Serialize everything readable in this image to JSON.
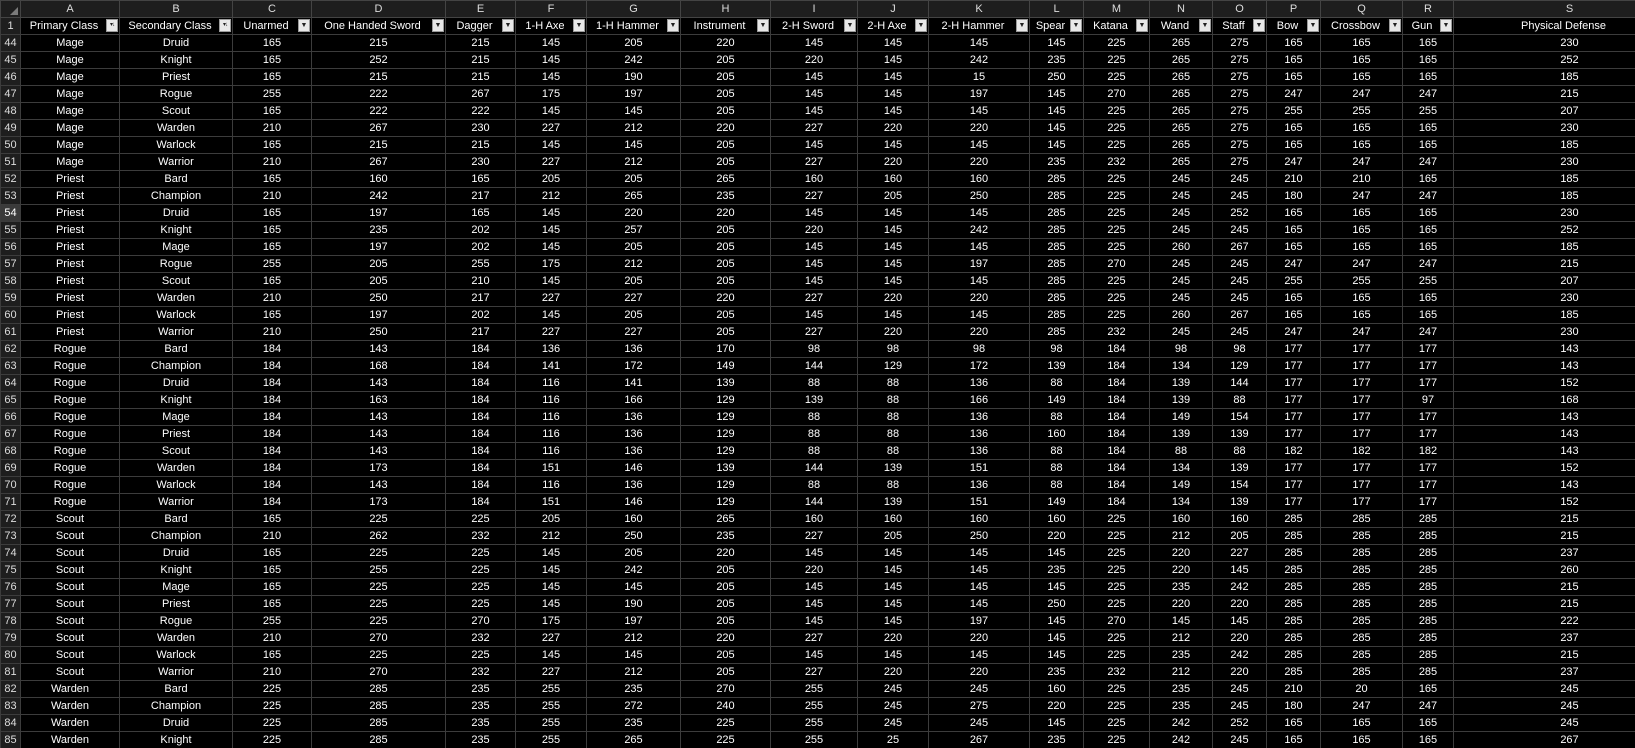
{
  "sheet": {
    "columns": [
      "A",
      "B",
      "C",
      "D",
      "E",
      "F",
      "G",
      "H",
      "I",
      "J",
      "K",
      "L",
      "M",
      "N",
      "O",
      "P",
      "Q",
      "R",
      "S"
    ],
    "header_row_number": "1",
    "headers": [
      {
        "label": "Primary Class",
        "filter_icon": "sort-filter-icon"
      },
      {
        "label": "Secondary Class",
        "filter_icon": "sort-filter-icon"
      },
      {
        "label": "Unarmed",
        "filter_icon": "filter-dropdown-icon"
      },
      {
        "label": "One Handed Sword",
        "filter_icon": "filter-dropdown-icon"
      },
      {
        "label": "Dagger",
        "filter_icon": "filter-dropdown-icon"
      },
      {
        "label": "1-H Axe",
        "filter_icon": "filter-dropdown-icon"
      },
      {
        "label": "1-H Hammer",
        "filter_icon": "filter-dropdown-icon"
      },
      {
        "label": "Instrument",
        "filter_icon": "filter-dropdown-icon"
      },
      {
        "label": "2-H Sword",
        "filter_icon": "filter-dropdown-icon"
      },
      {
        "label": "2-H Axe",
        "filter_icon": "filter-dropdown-icon"
      },
      {
        "label": "2-H Hammer",
        "filter_icon": "filter-dropdown-icon"
      },
      {
        "label": "Spear",
        "filter_icon": "filter-dropdown-icon"
      },
      {
        "label": "Katana",
        "filter_icon": "filter-dropdown-icon"
      },
      {
        "label": "Wand",
        "filter_icon": "filter-dropdown-icon"
      },
      {
        "label": "Staff",
        "filter_icon": "filter-dropdown-icon"
      },
      {
        "label": "Bow",
        "filter_icon": "filter-dropdown-icon"
      },
      {
        "label": "Crossbow",
        "filter_icon": "filter-dropdown-icon"
      },
      {
        "label": "Gun",
        "filter_icon": "filter-dropdown-icon"
      },
      {
        "label": "Physical Defense",
        "filter_icon": "filter-dropdown-icon"
      }
    ],
    "active_row": "54",
    "rows": [
      {
        "num": "44",
        "cells": [
          "Mage",
          "Druid",
          "165",
          "215",
          "215",
          "145",
          "205",
          "220",
          "145",
          "145",
          "145",
          "145",
          "225",
          "265",
          "275",
          "165",
          "165",
          "165",
          "230"
        ]
      },
      {
        "num": "45",
        "cells": [
          "Mage",
          "Knight",
          "165",
          "252",
          "215",
          "145",
          "242",
          "205",
          "220",
          "145",
          "242",
          "235",
          "225",
          "265",
          "275",
          "165",
          "165",
          "165",
          "252"
        ]
      },
      {
        "num": "46",
        "cells": [
          "Mage",
          "Priest",
          "165",
          "215",
          "215",
          "145",
          "190",
          "205",
          "145",
          "145",
          "15",
          "250",
          "225",
          "265",
          "275",
          "165",
          "165",
          "165",
          "185"
        ]
      },
      {
        "num": "47",
        "cells": [
          "Mage",
          "Rogue",
          "255",
          "222",
          "267",
          "175",
          "197",
          "205",
          "145",
          "145",
          "197",
          "145",
          "270",
          "265",
          "275",
          "247",
          "247",
          "247",
          "215"
        ]
      },
      {
        "num": "48",
        "cells": [
          "Mage",
          "Scout",
          "165",
          "222",
          "222",
          "145",
          "145",
          "205",
          "145",
          "145",
          "145",
          "145",
          "225",
          "265",
          "275",
          "255",
          "255",
          "255",
          "207"
        ]
      },
      {
        "num": "49",
        "cells": [
          "Mage",
          "Warden",
          "210",
          "267",
          "230",
          "227",
          "212",
          "220",
          "227",
          "220",
          "220",
          "145",
          "225",
          "265",
          "275",
          "165",
          "165",
          "165",
          "230"
        ]
      },
      {
        "num": "50",
        "cells": [
          "Mage",
          "Warlock",
          "165",
          "215",
          "215",
          "145",
          "145",
          "205",
          "145",
          "145",
          "145",
          "145",
          "225",
          "265",
          "275",
          "165",
          "165",
          "165",
          "185"
        ]
      },
      {
        "num": "51",
        "cells": [
          "Mage",
          "Warrior",
          "210",
          "267",
          "230",
          "227",
          "212",
          "205",
          "227",
          "220",
          "220",
          "235",
          "232",
          "265",
          "275",
          "247",
          "247",
          "247",
          "230"
        ]
      },
      {
        "num": "52",
        "cells": [
          "Priest",
          "Bard",
          "165",
          "160",
          "165",
          "205",
          "205",
          "265",
          "160",
          "160",
          "160",
          "285",
          "225",
          "245",
          "245",
          "210",
          "210",
          "165",
          "185"
        ]
      },
      {
        "num": "53",
        "cells": [
          "Priest",
          "Champion",
          "210",
          "242",
          "217",
          "212",
          "265",
          "235",
          "227",
          "205",
          "250",
          "285",
          "225",
          "245",
          "245",
          "180",
          "247",
          "247",
          "185"
        ]
      },
      {
        "num": "54",
        "cells": [
          "Priest",
          "Druid",
          "165",
          "197",
          "165",
          "145",
          "220",
          "220",
          "145",
          "145",
          "145",
          "285",
          "225",
          "245",
          "252",
          "165",
          "165",
          "165",
          "230"
        ]
      },
      {
        "num": "55",
        "cells": [
          "Priest",
          "Knight",
          "165",
          "235",
          "202",
          "145",
          "257",
          "205",
          "220",
          "145",
          "242",
          "285",
          "225",
          "245",
          "245",
          "165",
          "165",
          "165",
          "252"
        ]
      },
      {
        "num": "56",
        "cells": [
          "Priest",
          "Mage",
          "165",
          "197",
          "202",
          "145",
          "205",
          "205",
          "145",
          "145",
          "145",
          "285",
          "225",
          "260",
          "267",
          "165",
          "165",
          "165",
          "185"
        ]
      },
      {
        "num": "57",
        "cells": [
          "Priest",
          "Rogue",
          "255",
          "205",
          "255",
          "175",
          "212",
          "205",
          "145",
          "145",
          "197",
          "285",
          "270",
          "245",
          "245",
          "247",
          "247",
          "247",
          "215"
        ]
      },
      {
        "num": "58",
        "cells": [
          "Priest",
          "Scout",
          "165",
          "205",
          "210",
          "145",
          "205",
          "205",
          "145",
          "145",
          "145",
          "285",
          "225",
          "245",
          "245",
          "255",
          "255",
          "255",
          "207"
        ]
      },
      {
        "num": "59",
        "cells": [
          "Priest",
          "Warden",
          "210",
          "250",
          "217",
          "227",
          "227",
          "220",
          "227",
          "220",
          "220",
          "285",
          "225",
          "245",
          "245",
          "165",
          "165",
          "165",
          "230"
        ]
      },
      {
        "num": "60",
        "cells": [
          "Priest",
          "Warlock",
          "165",
          "197",
          "202",
          "145",
          "205",
          "205",
          "145",
          "145",
          "145",
          "285",
          "225",
          "260",
          "267",
          "165",
          "165",
          "165",
          "185"
        ]
      },
      {
        "num": "61",
        "cells": [
          "Priest",
          "Warrior",
          "210",
          "250",
          "217",
          "227",
          "227",
          "205",
          "227",
          "220",
          "220",
          "285",
          "232",
          "245",
          "245",
          "247",
          "247",
          "247",
          "230"
        ]
      },
      {
        "num": "62",
        "cells": [
          "Rogue",
          "Bard",
          "184",
          "143",
          "184",
          "136",
          "136",
          "170",
          "98",
          "98",
          "98",
          "98",
          "184",
          "98",
          "98",
          "177",
          "177",
          "177",
          "143"
        ]
      },
      {
        "num": "63",
        "cells": [
          "Rogue",
          "Champion",
          "184",
          "168",
          "184",
          "141",
          "172",
          "149",
          "144",
          "129",
          "172",
          "139",
          "184",
          "134",
          "129",
          "177",
          "177",
          "177",
          "143"
        ]
      },
      {
        "num": "64",
        "cells": [
          "Rogue",
          "Druid",
          "184",
          "143",
          "184",
          "116",
          "141",
          "139",
          "88",
          "88",
          "136",
          "88",
          "184",
          "139",
          "144",
          "177",
          "177",
          "177",
          "152"
        ]
      },
      {
        "num": "65",
        "cells": [
          "Rogue",
          "Knight",
          "184",
          "163",
          "184",
          "116",
          "166",
          "129",
          "139",
          "88",
          "166",
          "149",
          "184",
          "139",
          "88",
          "177",
          "177",
          "97",
          "168"
        ]
      },
      {
        "num": "66",
        "cells": [
          "Rogue",
          "Mage",
          "184",
          "143",
          "184",
          "116",
          "136",
          "129",
          "88",
          "88",
          "136",
          "88",
          "184",
          "149",
          "154",
          "177",
          "177",
          "177",
          "143"
        ]
      },
      {
        "num": "67",
        "cells": [
          "Rogue",
          "Priest",
          "184",
          "143",
          "184",
          "116",
          "136",
          "129",
          "88",
          "88",
          "136",
          "160",
          "184",
          "139",
          "139",
          "177",
          "177",
          "177",
          "143"
        ]
      },
      {
        "num": "68",
        "cells": [
          "Rogue",
          "Scout",
          "184",
          "143",
          "184",
          "116",
          "136",
          "129",
          "88",
          "88",
          "136",
          "88",
          "184",
          "88",
          "88",
          "182",
          "182",
          "182",
          "143"
        ]
      },
      {
        "num": "69",
        "cells": [
          "Rogue",
          "Warden",
          "184",
          "173",
          "184",
          "151",
          "146",
          "139",
          "144",
          "139",
          "151",
          "88",
          "184",
          "134",
          "139",
          "177",
          "177",
          "177",
          "152"
        ]
      },
      {
        "num": "70",
        "cells": [
          "Rogue",
          "Warlock",
          "184",
          "143",
          "184",
          "116",
          "136",
          "129",
          "88",
          "88",
          "136",
          "88",
          "184",
          "149",
          "154",
          "177",
          "177",
          "177",
          "143"
        ]
      },
      {
        "num": "71",
        "cells": [
          "Rogue",
          "Warrior",
          "184",
          "173",
          "184",
          "151",
          "146",
          "129",
          "144",
          "139",
          "151",
          "149",
          "184",
          "134",
          "139",
          "177",
          "177",
          "177",
          "152"
        ]
      },
      {
        "num": "72",
        "cells": [
          "Scout",
          "Bard",
          "165",
          "225",
          "225",
          "205",
          "160",
          "265",
          "160",
          "160",
          "160",
          "160",
          "225",
          "160",
          "160",
          "285",
          "285",
          "285",
          "215"
        ]
      },
      {
        "num": "73",
        "cells": [
          "Scout",
          "Champion",
          "210",
          "262",
          "232",
          "212",
          "250",
          "235",
          "227",
          "205",
          "250",
          "220",
          "225",
          "212",
          "205",
          "285",
          "285",
          "285",
          "215"
        ]
      },
      {
        "num": "74",
        "cells": [
          "Scout",
          "Druid",
          "165",
          "225",
          "225",
          "145",
          "205",
          "220",
          "145",
          "145",
          "145",
          "145",
          "225",
          "220",
          "227",
          "285",
          "285",
          "285",
          "237"
        ]
      },
      {
        "num": "75",
        "cells": [
          "Scout",
          "Knight",
          "165",
          "255",
          "225",
          "145",
          "242",
          "205",
          "220",
          "145",
          "145",
          "235",
          "225",
          "220",
          "145",
          "285",
          "285",
          "285",
          "260"
        ]
      },
      {
        "num": "76",
        "cells": [
          "Scout",
          "Mage",
          "165",
          "225",
          "225",
          "145",
          "145",
          "205",
          "145",
          "145",
          "145",
          "145",
          "225",
          "235",
          "242",
          "285",
          "285",
          "285",
          "215"
        ]
      },
      {
        "num": "77",
        "cells": [
          "Scout",
          "Priest",
          "165",
          "225",
          "225",
          "145",
          "190",
          "205",
          "145",
          "145",
          "145",
          "250",
          "225",
          "220",
          "220",
          "285",
          "285",
          "285",
          "215"
        ]
      },
      {
        "num": "78",
        "cells": [
          "Scout",
          "Rogue",
          "255",
          "225",
          "270",
          "175",
          "197",
          "205",
          "145",
          "145",
          "197",
          "145",
          "270",
          "145",
          "145",
          "285",
          "285",
          "285",
          "222"
        ]
      },
      {
        "num": "79",
        "cells": [
          "Scout",
          "Warden",
          "210",
          "270",
          "232",
          "227",
          "212",
          "220",
          "227",
          "220",
          "220",
          "145",
          "225",
          "212",
          "220",
          "285",
          "285",
          "285",
          "237"
        ]
      },
      {
        "num": "80",
        "cells": [
          "Scout",
          "Warlock",
          "165",
          "225",
          "225",
          "145",
          "145",
          "205",
          "145",
          "145",
          "145",
          "145",
          "225",
          "235",
          "242",
          "285",
          "285",
          "285",
          "215"
        ]
      },
      {
        "num": "81",
        "cells": [
          "Scout",
          "Warrior",
          "210",
          "270",
          "232",
          "227",
          "212",
          "205",
          "227",
          "220",
          "220",
          "235",
          "232",
          "212",
          "220",
          "285",
          "285",
          "285",
          "237"
        ]
      },
      {
        "num": "82",
        "cells": [
          "Warden",
          "Bard",
          "225",
          "285",
          "235",
          "255",
          "235",
          "270",
          "255",
          "245",
          "245",
          "160",
          "225",
          "235",
          "245",
          "210",
          "20",
          "165",
          "245"
        ]
      },
      {
        "num": "83",
        "cells": [
          "Warden",
          "Champion",
          "225",
          "285",
          "235",
          "255",
          "272",
          "240",
          "255",
          "245",
          "275",
          "220",
          "225",
          "235",
          "245",
          "180",
          "247",
          "247",
          "245"
        ]
      },
      {
        "num": "84",
        "cells": [
          "Warden",
          "Druid",
          "225",
          "285",
          "235",
          "255",
          "235",
          "225",
          "255",
          "245",
          "245",
          "145",
          "225",
          "242",
          "252",
          "165",
          "165",
          "165",
          "245"
        ]
      },
      {
        "num": "85",
        "cells": [
          "Warden",
          "Knight",
          "225",
          "285",
          "235",
          "255",
          "265",
          "225",
          "255",
          "25",
          "267",
          "235",
          "225",
          "242",
          "245",
          "165",
          "165",
          "165",
          "267"
        ]
      }
    ]
  }
}
